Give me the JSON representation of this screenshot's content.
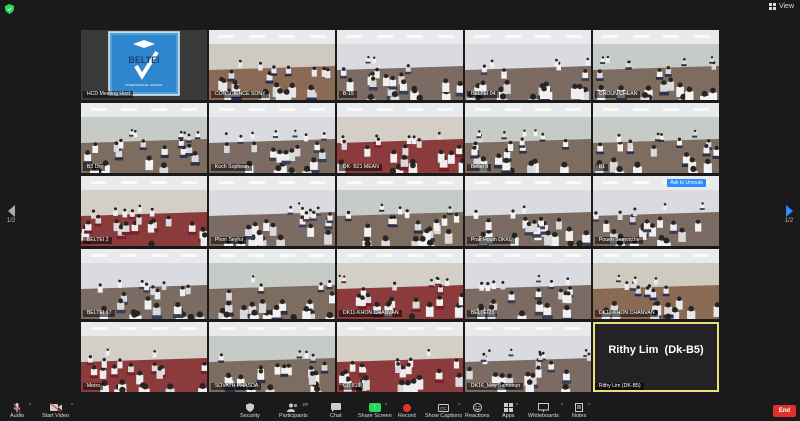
{
  "topbar": {
    "view_label": "View"
  },
  "colors": {
    "accent": "#2d8cff",
    "share_green": "#23d959",
    "end_red": "#e0302b",
    "active_speaker": "#e8e07a",
    "muted_mic": "#e0332e"
  },
  "tiles": [
    {
      "name": "HCD Meeting Host",
      "scene": "logo",
      "logo_text": "BELTEI",
      "logo_sub": "INTERNATIONAL SCHOOL"
    },
    {
      "name": "CONSCIENCE SONY",
      "scene": "room"
    },
    {
      "name": "B-15",
      "scene": "hall"
    },
    {
      "name": "BELTEI 04",
      "scene": "hall"
    },
    {
      "name": "CHOUN CHEAN",
      "scene": "class"
    },
    {
      "name": "B3 Dty",
      "scene": "class"
    },
    {
      "name": "Koch Sophean",
      "scene": "hall"
    },
    {
      "name": "DK- B21 MEAN",
      "scene": "stage"
    },
    {
      "name": "Beltei 9",
      "scene": "class"
    },
    {
      "name": "B1",
      "scene": "class"
    },
    {
      "name": "BELTEI 2",
      "scene": "stage"
    },
    {
      "name": "Phon Seyha",
      "scene": "hall"
    },
    {
      "name": "",
      "scene": "class"
    },
    {
      "name": "Prak Houth DKKL",
      "scene": "hall"
    },
    {
      "name": "Pouen Samvicthe",
      "scene": "hall",
      "ask_unmute": "Ask to Unmute"
    },
    {
      "name": "BELTEI 17",
      "scene": "hall"
    },
    {
      "name": "",
      "scene": "class"
    },
    {
      "name": "DK11-KHON CHANVAN",
      "scene": "stage"
    },
    {
      "name": "BELTEI23",
      "scene": "hall"
    },
    {
      "name": "DK11-KHON CHANVAN",
      "scene": "room"
    },
    {
      "name": "Metro",
      "scene": "stage"
    },
    {
      "name": "SOVATH PHASDA",
      "scene": "class"
    },
    {
      "name": "CD 819",
      "scene": "stage"
    },
    {
      "name": "DK16_Mey Samoeun",
      "scene": "hall"
    },
    {
      "name": "Rithy Lim  (DK-B5)",
      "scene": "name_only",
      "big_name": "Rithy Lim  (Dk-B5)",
      "active": true
    }
  ],
  "pager": {
    "left": "1/2",
    "right": "1/2"
  },
  "toolbar": {
    "audio": "Audio",
    "start_video": "Start Video",
    "security": "Security",
    "participants": "Participants",
    "participants_count": "27",
    "chat": "Chat",
    "share_screen": "Share Screen",
    "record": "Record",
    "show_captions": "Show Captions",
    "reactions": "Reactions",
    "apps": "Apps",
    "whiteboards": "Whiteboards",
    "notes": "Notes",
    "end": "End"
  },
  "icons": [
    "shield-icon",
    "view-grid-icon",
    "mic-muted-icon",
    "video-off-icon",
    "security-shield-icon",
    "participants-icon",
    "chat-icon",
    "share-screen-icon",
    "record-icon",
    "captions-icon",
    "reactions-icon",
    "apps-icon",
    "whiteboards-icon",
    "notes-icon",
    "arrow-left-icon",
    "arrow-right-icon"
  ]
}
